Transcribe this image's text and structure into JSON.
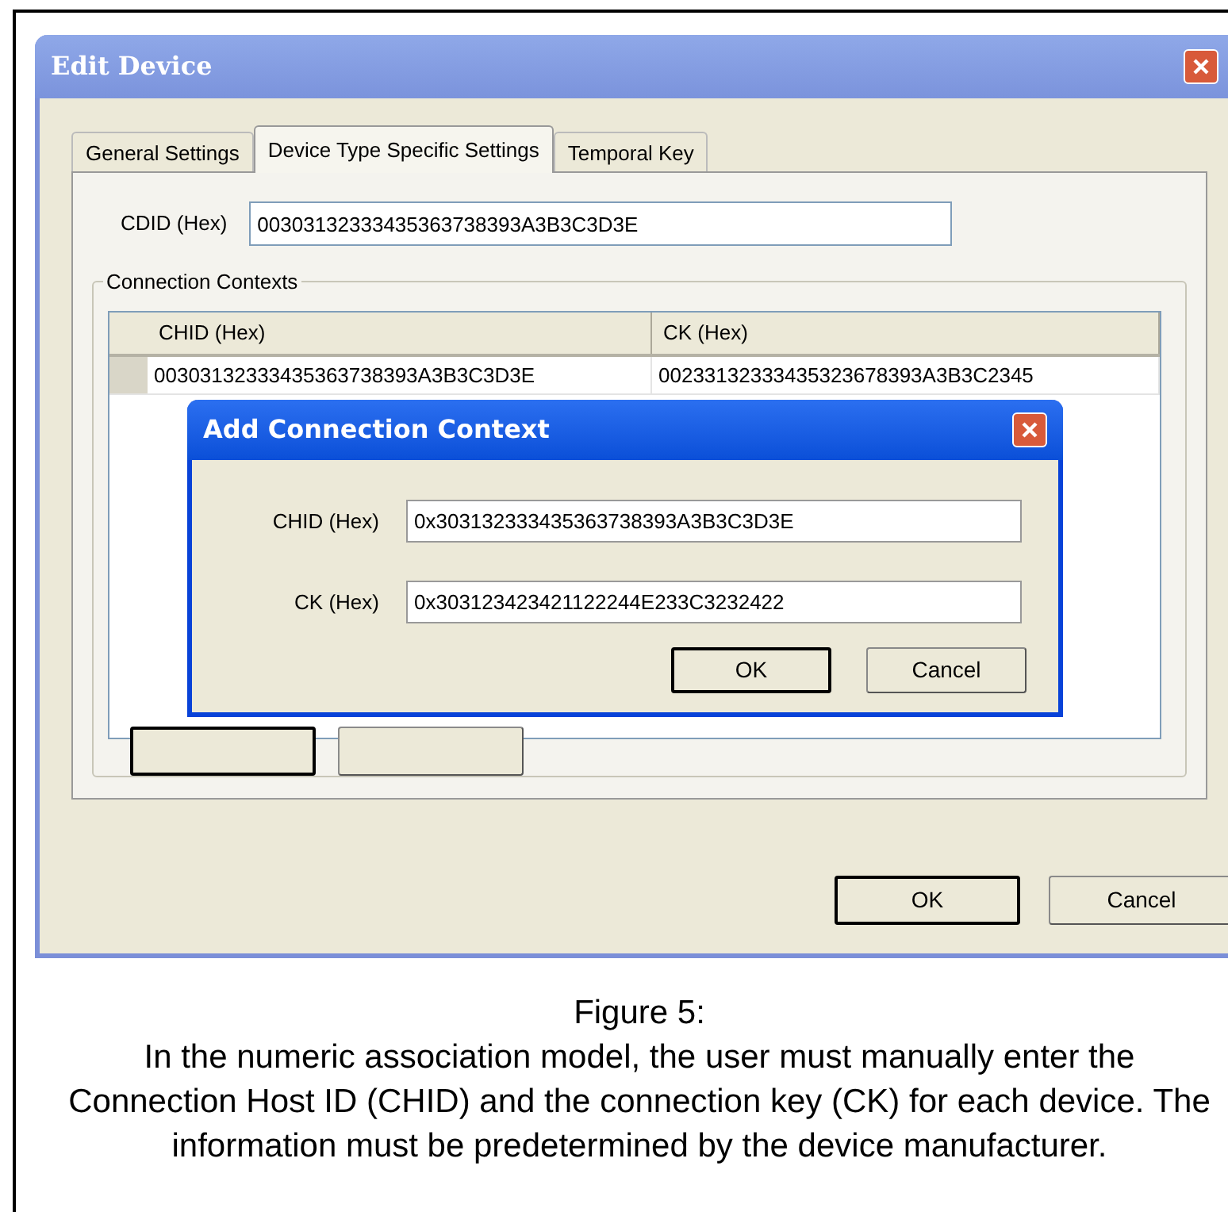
{
  "window": {
    "title": "Edit Device"
  },
  "tabs": [
    {
      "label": "General Settings",
      "selected": false
    },
    {
      "label": "Device Type Specific Settings",
      "selected": true
    },
    {
      "label": "Temporal Key",
      "selected": false
    }
  ],
  "cdid": {
    "label": "CDID (Hex)",
    "value": "00303132333435363738393A3B3C3D3E"
  },
  "connection_contexts": {
    "title": "Connection Contexts",
    "columns": [
      "CHID (Hex)",
      "CK (Hex)"
    ],
    "rows": [
      [
        "00303132333435363738393A3B3C3D3E",
        "00233132333435323678393A3B3C2345"
      ]
    ]
  },
  "buttons": [
    "OK",
    "Cancel"
  ],
  "dialog": {
    "title": "Add Connection Context",
    "fields": [
      {
        "label": "CHID (Hex)",
        "value": "0x303132333435363738393A3B3C3D3E"
      },
      {
        "label": "CK (Hex)",
        "value": "0x303123423421122244E233C3232422"
      }
    ],
    "buttons": [
      "OK",
      "Cancel"
    ]
  },
  "caption": {
    "title": "Figure 5:",
    "text": "In the numeric association model, the user must manually enter the Connection Host ID (CHID) and the connection key (CK) for each device.  The information must be predetermined by the device manufacturer."
  }
}
